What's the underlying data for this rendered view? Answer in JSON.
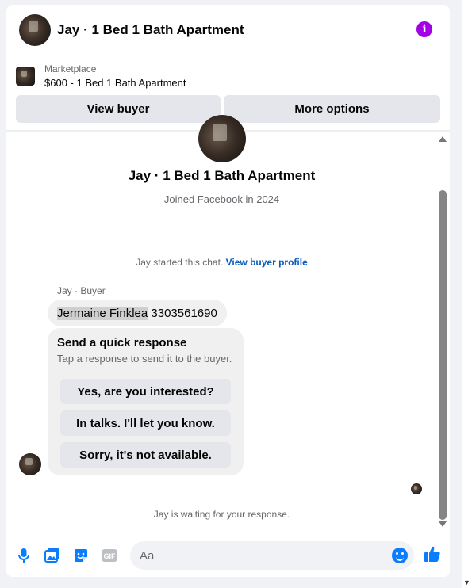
{
  "header": {
    "title": "Jay · 1 Bed 1 Bath Apartment"
  },
  "listing": {
    "kicker": "Marketplace",
    "title": "$600 - 1 Bed 1 Bath Apartment"
  },
  "actions": {
    "view_buyer": "View buyer",
    "more_options": "More options"
  },
  "profile": {
    "name": "Jay · 1 Bed 1 Bath Apartment",
    "joined": "Joined Facebook in 2024"
  },
  "system": {
    "text": "Jay started this chat.",
    "link": "View buyer profile"
  },
  "message": {
    "sender": "Jay · Buyer",
    "highlighted": "Jermaine Finklea",
    "rest": "3303561690"
  },
  "quick_response": {
    "title": "Send a quick response",
    "subtitle": "Tap a response to send it to the buyer.",
    "options": [
      "Yes, are you interested?",
      "In talks. I'll let you know.",
      "Sorry, it's not available."
    ]
  },
  "status": {
    "waiting": "Jay is waiting for your response."
  },
  "composer": {
    "placeholder": "Aa",
    "gif_label": "GIF"
  },
  "colors": {
    "accent": "#0a7cff",
    "info": "#a300e8",
    "link": "#0a5cb8"
  }
}
